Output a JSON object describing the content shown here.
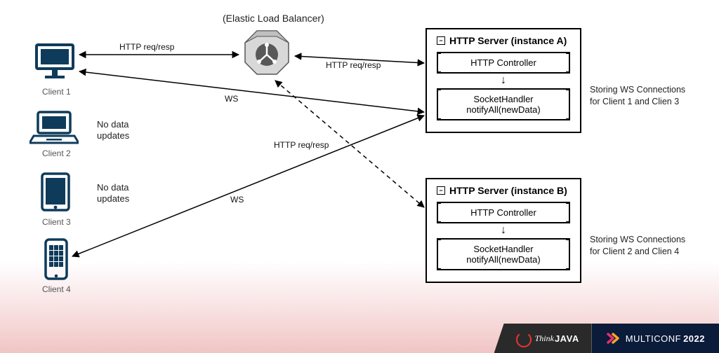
{
  "elb": {
    "label": "(Elastic Load Balancer)"
  },
  "clients": [
    {
      "label": "Client 1"
    },
    {
      "label": "Client 2"
    },
    {
      "label": "Client 3"
    },
    {
      "label": "Client 4"
    }
  ],
  "notes": {
    "client2": "No data\nupdates",
    "client3": "No data\nupdates"
  },
  "edges": {
    "http_left": "HTTP req/resp",
    "http_right": "HTTP req/resp",
    "http_dashed": "HTTP req/resp",
    "ws1": "WS",
    "ws3": "WS"
  },
  "servers": {
    "a": {
      "title": "HTTP Server (instance A)",
      "controller": "HTTP Controller",
      "handler_l1": "SocketHandler",
      "handler_l2": "notifyAll(newData)",
      "side": "Storing WS Connections\nfor Client 1 and Clien 3"
    },
    "b": {
      "title": "HTTP Server (instance B)",
      "controller": "HTTP Controller",
      "handler_l1": "SocketHandler",
      "handler_l2": "notifyAll(newData)",
      "side": "Storing WS Connections\nfor Client 2 and Clien 4"
    }
  },
  "footer": {
    "think": "Think",
    "java": "JAVA",
    "multiconf": "MULTICONF",
    "year": "2022"
  }
}
